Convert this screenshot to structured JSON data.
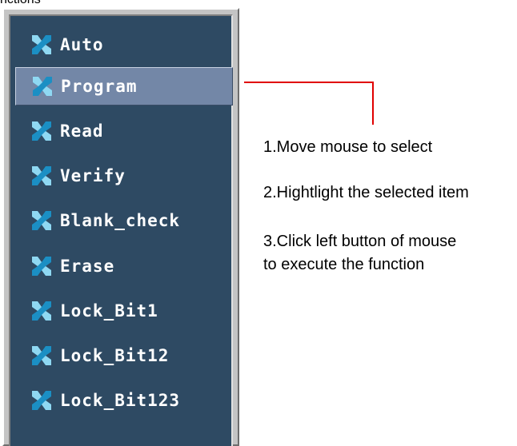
{
  "top_fragment": "nctions",
  "menu": {
    "items": [
      {
        "label": "Auto",
        "icon": "blue-x-icon",
        "selected": false
      },
      {
        "label": "Program",
        "icon": "blue-x-icon",
        "selected": true
      },
      {
        "label": "Read",
        "icon": "blue-x-icon",
        "selected": false
      },
      {
        "label": "Verify",
        "icon": "blue-x-icon",
        "selected": false
      },
      {
        "label": "Blank_check",
        "icon": "blue-x-icon",
        "selected": false
      },
      {
        "label": "Erase",
        "icon": "blue-x-icon",
        "selected": false
      },
      {
        "label": "Lock_Bit1",
        "icon": "blue-x-icon",
        "selected": false
      },
      {
        "label": "Lock_Bit12",
        "icon": "blue-x-icon",
        "selected": false
      },
      {
        "label": "Lock_Bit123",
        "icon": "blue-x-icon",
        "selected": false
      }
    ]
  },
  "instructions": {
    "step1": "1.Move mouse to select",
    "step2": "2.Hightlight the selected item",
    "step3_line1": "3.Click left button of mouse",
    "step3_line2": "to execute the function"
  },
  "colors": {
    "panel_bg": "#2e4a63",
    "selected_bg": "#7387a7",
    "callout_line": "#e00000",
    "icon_light": "#8fd8f2",
    "icon_dark": "#1b8fc4"
  }
}
